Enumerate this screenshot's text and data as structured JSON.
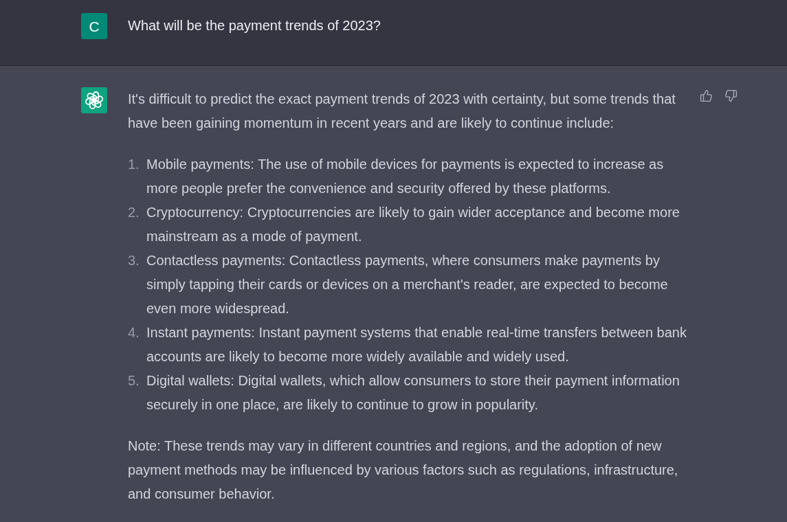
{
  "messages": [
    {
      "kind": "user",
      "avatar_letter": "C",
      "text": "What will be the payment trends of 2023?"
    },
    {
      "kind": "assistant",
      "intro": "It's difficult to predict the exact payment trends of 2023 with certainty, but some trends that have been gaining momentum in recent years and are likely to continue include:",
      "items": [
        {
          "number": "1.",
          "text": "Mobile payments: The use of mobile devices for payments is expected to increase as more people prefer the convenience and security offered by these platforms."
        },
        {
          "number": "2.",
          "text": "Cryptocurrency: Cryptocurrencies are likely to gain wider acceptance and become more mainstream as a mode of payment."
        },
        {
          "number": "3.",
          "text": "Contactless payments: Contactless payments, where consumers make payments by simply tapping their cards or devices on a merchant's reader, are expected to become even more widespread."
        },
        {
          "number": "4.",
          "text": "Instant payments: Instant payment systems that enable real-time transfers between bank accounts are likely to become more widely available and widely used."
        },
        {
          "number": "5.",
          "text": "Digital wallets: Digital wallets, which allow consumers to store their payment information securely in one place, are likely to continue to grow in popularity."
        }
      ],
      "note": "Note: These trends may vary in different countries and regions, and the adoption of new payment methods may be influenced by various factors such as regulations, infrastructure, and consumer behavior."
    }
  ]
}
